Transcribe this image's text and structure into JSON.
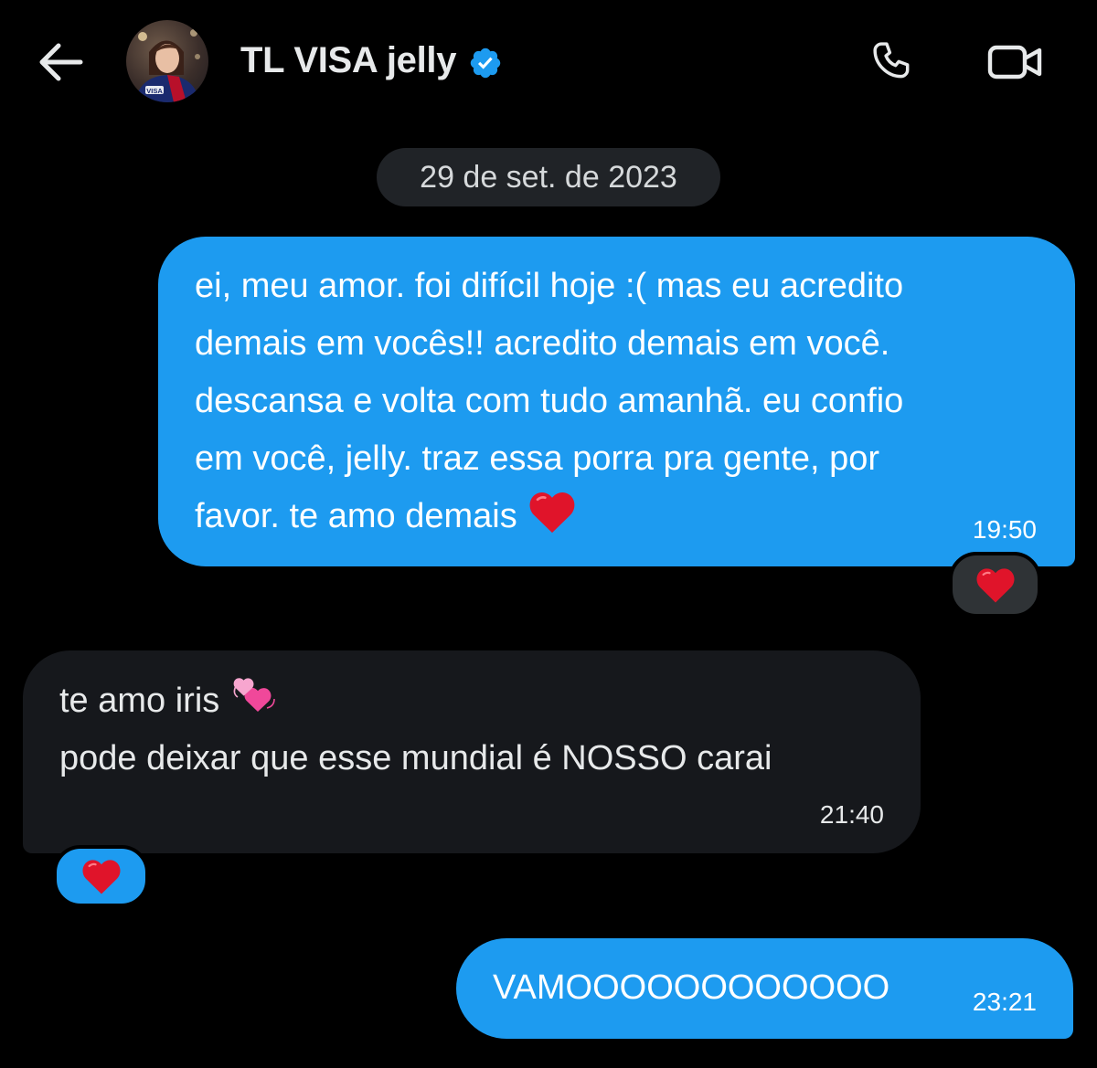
{
  "header": {
    "contact_name": "TL VISA jelly",
    "back_icon": "arrow-left-icon",
    "verified_icon": "verified-badge-icon",
    "phone_icon": "phone-icon",
    "video_icon": "video-camera-icon",
    "verified_color": "#1d9bf0",
    "icon_color": "#e7e9ea"
  },
  "date_separator": "29 de set. de 2023",
  "messages": [
    {
      "direction": "sent",
      "text": "ei, meu amor. foi difícil hoje :( mas eu acredito\ndemais em vocês!! acredito demais em você.\ndescansa e volta com tudo amanhã. eu confio\nem você, jelly. traz essa porra pra gente, por\nfavor. te amo demais",
      "emoji": "red-heart",
      "time": "19:50",
      "reaction": "red-heart"
    },
    {
      "direction": "received",
      "line1": "te amo iris",
      "line1_emoji": "two-hearts",
      "line2": "pode deixar que esse mundial é NOSSO carai",
      "time": "21:40",
      "reaction": "red-heart"
    },
    {
      "direction": "sent",
      "text": "VAMOOOOOOOOOOOO",
      "time": "23:21"
    }
  ],
  "colors": {
    "background": "#000000",
    "sent_bubble": "#1d9bf0",
    "received_bubble": "#16181c",
    "date_pill": "#202327",
    "heart": "#e0142a"
  }
}
